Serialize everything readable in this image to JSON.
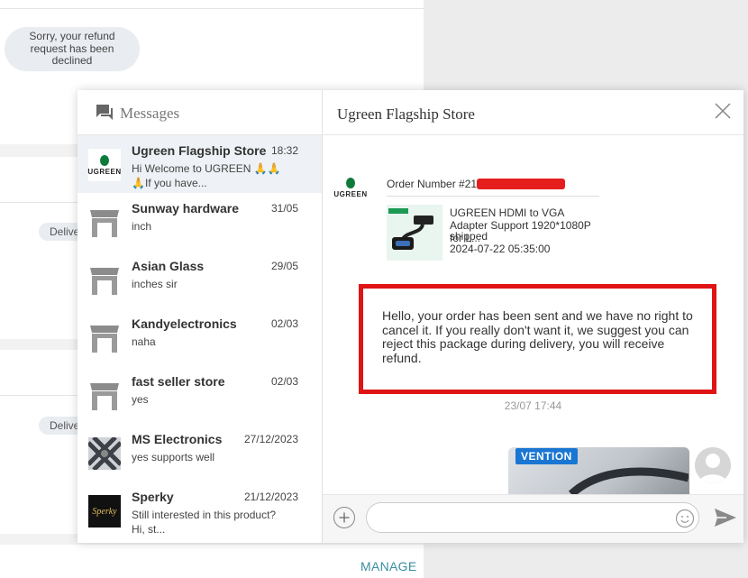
{
  "background": {
    "declined_bubble": [
      "Sorry, your refund",
      "request has been",
      "declined"
    ],
    "status_pill": "Delivered",
    "manage_link": "MANAGE"
  },
  "messages_panel": {
    "title": "Messages",
    "conversations": [
      {
        "name": "Ugreen Flagship Store",
        "time": "18:32",
        "preview": "Hi Welcome to UGREEN 🙏🙏🙏If you have...",
        "avatar": "ugreen-logo",
        "active": true
      },
      {
        "name": "Sunway hardware",
        "time": "31/05",
        "preview": "inch",
        "avatar": "store-icon"
      },
      {
        "name": "Asian Glass",
        "time": "29/05",
        "preview": "inches sir",
        "avatar": "store-icon"
      },
      {
        "name": "Kandyelectronics",
        "time": "02/03",
        "preview": "naha",
        "avatar": "store-icon"
      },
      {
        "name": "fast seller store",
        "time": "02/03",
        "preview": "yes",
        "avatar": "store-icon"
      },
      {
        "name": "MS Electronics",
        "time": "27/12/2023",
        "preview": "yes supports well",
        "avatar": "ms-electronics-thumb"
      },
      {
        "name": "Sperky",
        "time": "21/12/2023",
        "preview": "Still interested in this product? Hi, st...",
        "avatar": "sperky-thumb"
      }
    ]
  },
  "chat": {
    "store_name": "Ugreen Flagship Store",
    "logo_text": "UGREEN",
    "order": {
      "label": "Order Number #21",
      "product_title": "UGREEN HDMI to VGA Adapter Support 1920*1080P for L...",
      "status": "shipped",
      "date": "2024-07-22 05:35:00"
    },
    "message_text": "Hello, your order has been sent and we have no right to cancel it. If you really don't want it, we suggest you can reject this package during delivery, you will receive refund.",
    "message_time": "23/07 17:44",
    "image_brand": "VENTION",
    "input_placeholder": ""
  },
  "colors": {
    "highlight_border": "#e01414",
    "redaction": "#e51d1d",
    "manage_link": "#3a8fa0",
    "ugreen_green": "#0e7a3a",
    "vention_blue": "#1976d2"
  }
}
